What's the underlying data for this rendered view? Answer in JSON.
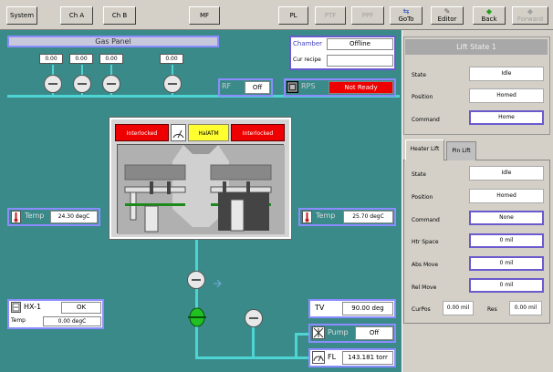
{
  "toolbar": {
    "system": "System",
    "cha": "Ch A",
    "chb": "Ch B",
    "mf": "MF",
    "pl": "PL",
    "ptf": "PTF",
    "ppf": "PPF",
    "goto": "GoTo",
    "editor": "Editor",
    "back": "Back",
    "forward": "Forward"
  },
  "gas": {
    "title": "Gas Panel",
    "flows": [
      "0.00",
      "0.00",
      "0.00",
      "0.00"
    ]
  },
  "chamber_status": {
    "label": "Chamber",
    "value": "Offline",
    "recipe_label": "Cur recipe",
    "recipe_value": ""
  },
  "rf": {
    "label": "RF",
    "value": "Off"
  },
  "rps": {
    "label": "RPS",
    "value": "Not Ready"
  },
  "chamber": {
    "interlock_left": "Interlocked",
    "center": "HalATM",
    "interlock_right": "Interlocked"
  },
  "temp_left": {
    "label": "Temp",
    "value": "24.30 degC"
  },
  "temp_right": {
    "label": "Temp",
    "value": "25.70 degC"
  },
  "hx": {
    "label": "HX-1",
    "value": "OK",
    "temp_label": "Temp",
    "temp_value": "0.00 degC"
  },
  "tv": {
    "label": "TV",
    "value": "90.00 deg"
  },
  "pump": {
    "label": "Pump",
    "value": "Off"
  },
  "pressure": {
    "label": "FL",
    "value": "143.181 torr"
  },
  "lift": {
    "title": "Lift State 1",
    "state_label": "State",
    "state_value": "Idle",
    "position_label": "Position",
    "position_value": "Homed",
    "command_label": "Command",
    "command_value": "Home"
  },
  "tabs": {
    "heater": "Heater Lift",
    "pin": "Pin Lift"
  },
  "heater": {
    "state_label": "State",
    "state_value": "Idle",
    "position_label": "Position",
    "position_value": "Homed",
    "command_label": "Command",
    "command_value": "None",
    "htr_space_label": "Htr Space",
    "htr_space_value": "0 mil",
    "abs_move_label": "Abs Move",
    "abs_move_value": "0 mil",
    "rel_move_label": "Rel Move",
    "rel_move_value": "0 mil",
    "curpos_label": "CurPos",
    "curpos_value": "0.00 mil",
    "res_label": "Res",
    "res_value": "0.00 mil"
  },
  "colors": {
    "panel": "#3a8a8a",
    "pipe": "#4fd4d4",
    "interlock": "#ee0000",
    "status_bad": "#ee0000",
    "accent": "#6a5acd"
  }
}
